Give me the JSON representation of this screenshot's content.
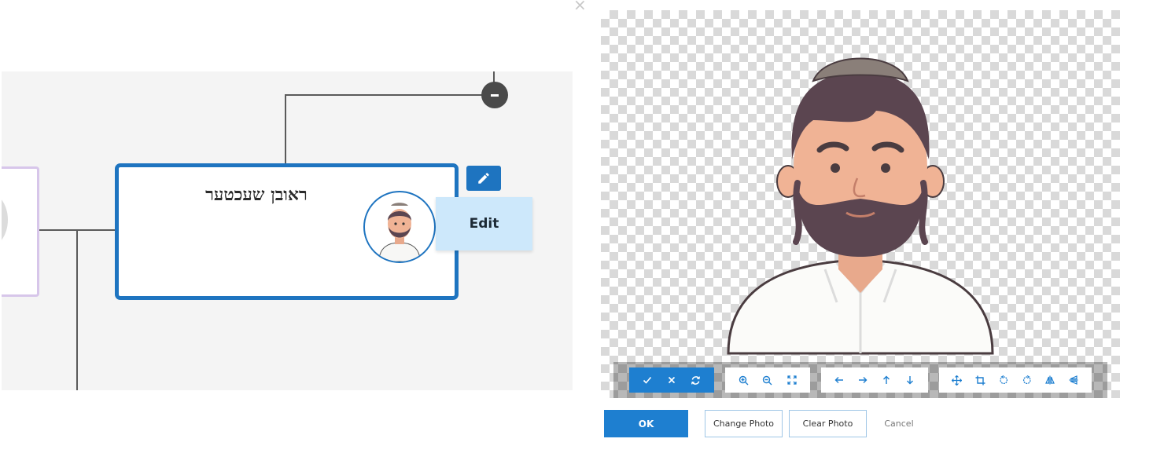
{
  "node": {
    "name": "ראובן שעכטער"
  },
  "edit": {
    "tooltip": "Edit"
  },
  "editor": {
    "toolbar": {
      "confirm_group": [
        "check-icon",
        "cancel-icon",
        "reset-icon"
      ],
      "zoom_group": [
        "zoom-in-icon",
        "zoom-out-icon",
        "fit-icon"
      ],
      "move_group": [
        "arrow-left-icon",
        "arrow-right-icon",
        "arrow-up-icon",
        "arrow-down-icon"
      ],
      "transform_group": [
        "move-icon",
        "crop-icon",
        "rotate-left-icon",
        "rotate-right-icon",
        "flip-horizontal-icon",
        "flip-vertical-icon"
      ]
    }
  },
  "actions": {
    "ok": "OK",
    "change_photo": "Change Photo",
    "clear_photo": "Clear Photo",
    "cancel": "Cancel"
  },
  "colors": {
    "accent": "#1e7fd0",
    "node_border": "#1e74c0",
    "tooltip_bg": "#cde8fb",
    "prev_node_border": "#d7c6ea"
  }
}
